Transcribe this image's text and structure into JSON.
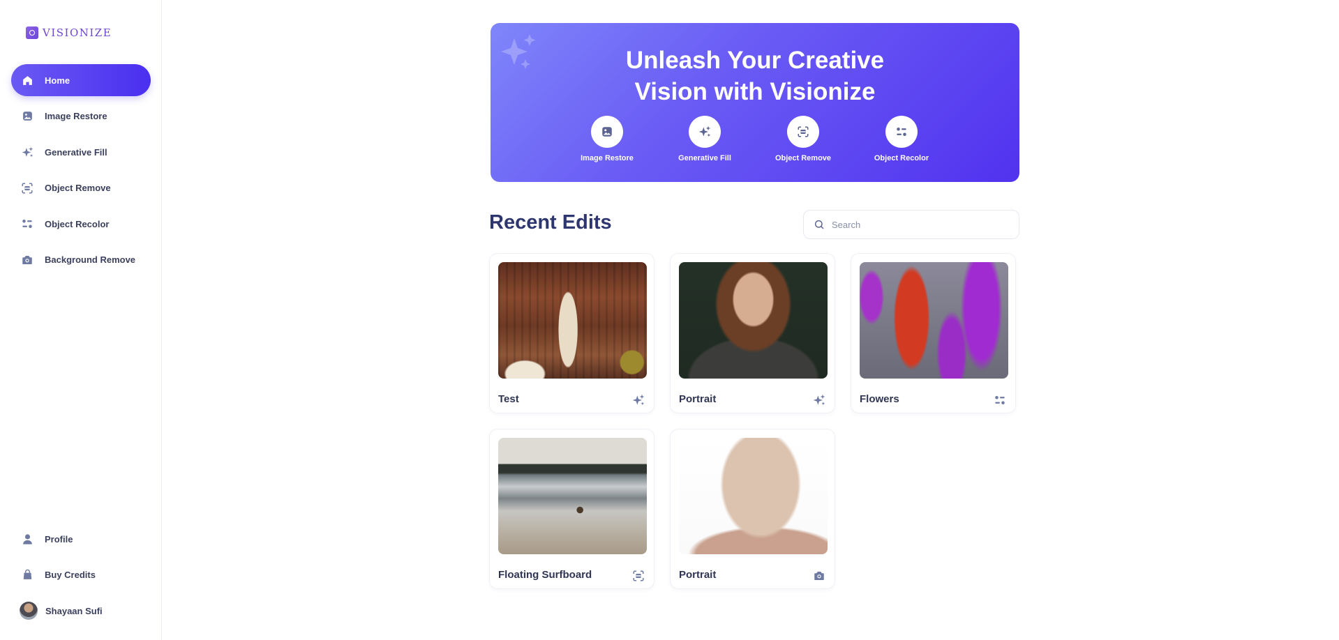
{
  "app": {
    "logo_text": "VISIONIZE",
    "accent": "#4f35f0"
  },
  "sidebar": {
    "items": [
      {
        "label": "Home",
        "icon": "home-icon",
        "active": true
      },
      {
        "label": "Image Restore",
        "icon": "image-icon"
      },
      {
        "label": "Generative Fill",
        "icon": "sparkles-icon"
      },
      {
        "label": "Object Remove",
        "icon": "scan-icon"
      },
      {
        "label": "Object Recolor",
        "icon": "filter-icon"
      },
      {
        "label": "Background Remove",
        "icon": "camera-icon"
      }
    ],
    "bottom_items": [
      {
        "label": "Profile",
        "icon": "user-icon"
      },
      {
        "label": "Buy Credits",
        "icon": "bag-icon"
      }
    ],
    "user": {
      "name": "Shayaan Sufi"
    }
  },
  "hero": {
    "title_line1": "Unleash Your Creative",
    "title_line2": "Vision with Visionize",
    "actions": [
      {
        "label": "Image Restore",
        "icon": "image-icon"
      },
      {
        "label": "Generative Fill",
        "icon": "sparkles-icon"
      },
      {
        "label": "Object Remove",
        "icon": "scan-icon"
      },
      {
        "label": "Object Recolor",
        "icon": "filter-icon"
      }
    ]
  },
  "recent": {
    "title": "Recent Edits",
    "search_placeholder": "Search",
    "cards": [
      {
        "title": "Test",
        "icon": "sparkles-icon"
      },
      {
        "title": "Portrait",
        "icon": "sparkles-icon"
      },
      {
        "title": "Flowers",
        "icon": "filter-icon"
      },
      {
        "title": "Floating Surfboard",
        "icon": "scan-icon"
      },
      {
        "title": "Portrait",
        "icon": "camera-icon"
      }
    ]
  }
}
